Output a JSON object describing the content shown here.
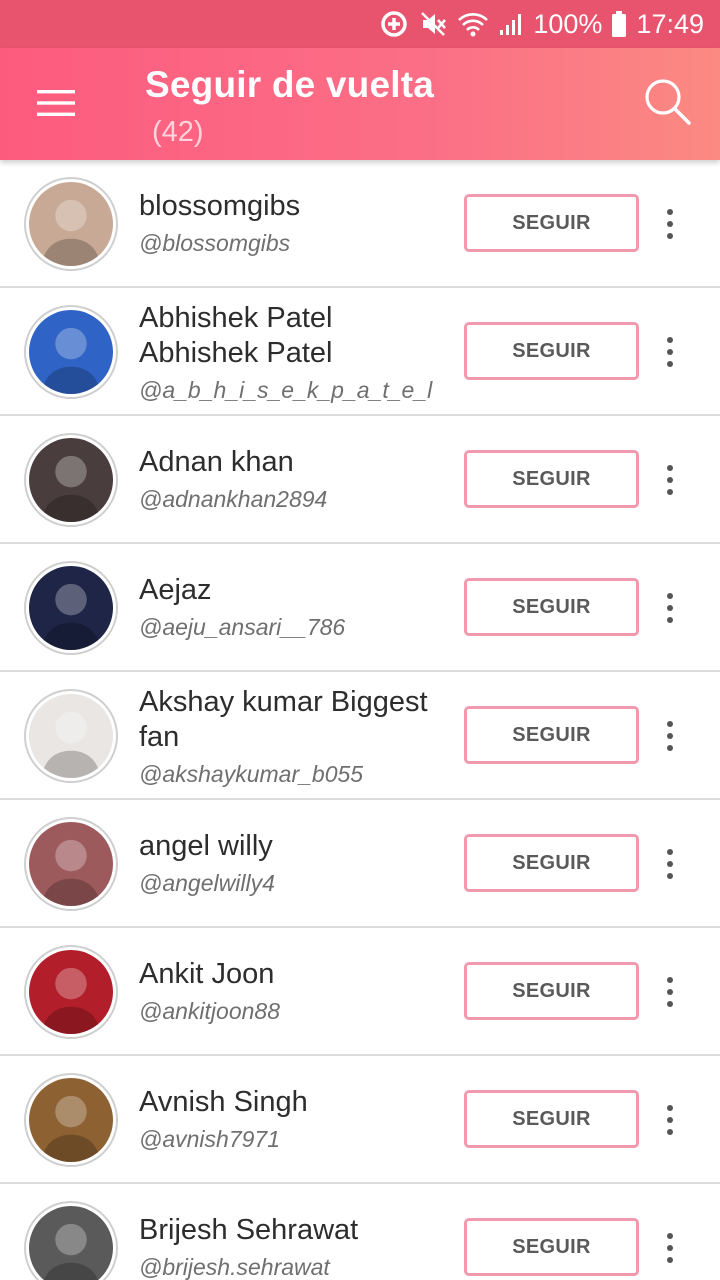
{
  "status_bar": {
    "battery": "100%",
    "time": "17:49"
  },
  "app_bar": {
    "title": "Seguir de vuelta",
    "count": "(42)"
  },
  "users": [
    {
      "name": "blossomgibs",
      "handle": "@blossomgibs",
      "button": "SEGUIR",
      "avatar_color": "#c7a995"
    },
    {
      "name": "Abhishek Patel Abhishek Patel",
      "handle": "@a_b_h_i_s_e_k_p_a_t_e_l",
      "button": "SEGUIR",
      "avatar_color": "#2f63c6"
    },
    {
      "name": "Adnan khan",
      "handle": "@adnankhan2894",
      "button": "SEGUIR",
      "avatar_color": "#4a3d3d"
    },
    {
      "name": "Aejaz",
      "handle": "@aeju_ansari__786",
      "button": "SEGUIR",
      "avatar_color": "#1e2546"
    },
    {
      "name": "Akshay kumar Biggest fan",
      "handle": "@akshaykumar_b055",
      "button": "SEGUIR",
      "avatar_color": "#e9e6e3"
    },
    {
      "name": "angel willy",
      "handle": "@angelwilly4",
      "button": "SEGUIR",
      "avatar_color": "#9d5a5d"
    },
    {
      "name": "Ankit Joon",
      "handle": "@ankitjoon88",
      "button": "SEGUIR",
      "avatar_color": "#b21f2a"
    },
    {
      "name": "Avnish Singh",
      "handle": "@avnish7971",
      "button": "SEGUIR",
      "avatar_color": "#8d6132"
    },
    {
      "name": "Brijesh Sehrawat",
      "handle": "@brijesh.sehrawat",
      "button": "SEGUIR",
      "avatar_color": "#5a5a5a"
    }
  ]
}
